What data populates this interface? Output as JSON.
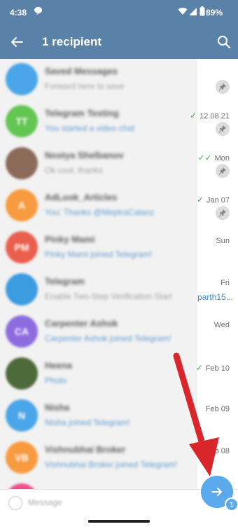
{
  "status_bar": {
    "time": "4:38",
    "battery": "89%"
  },
  "header": {
    "title": "1 recipient"
  },
  "chats": [
    {
      "name": "Saved Messages",
      "preview": "Forward here to save",
      "date": "",
      "ticks": "",
      "pinned": true,
      "avatar_color": "#4aa6e8",
      "avatar_text": "",
      "preview_muted": true
    },
    {
      "name": "Telegram Testing",
      "preview": "You started a video chat",
      "date": "12.08.21",
      "ticks": "✓",
      "pinned": true,
      "avatar_color": "#63c653",
      "avatar_text": "TT",
      "preview_muted": false
    },
    {
      "name": "Nostya Shelbanov",
      "preview": "Ok cool, thanks",
      "date": "Mon",
      "ticks": "✓✓",
      "pinned": true,
      "avatar_color": "#8b6a5a",
      "avatar_text": "",
      "preview_muted": true
    },
    {
      "name": "AdLook_Articles",
      "preview": "You: Thanks @MeptraCalanz",
      "date": "Jan 07",
      "ticks": "✓",
      "pinned": true,
      "avatar_color": "#f89a3f",
      "avatar_text": "A",
      "preview_muted": false
    },
    {
      "name": "Pinky Mami",
      "preview": "Pinky Mami joined Telegram!",
      "date": "Sun",
      "ticks": "",
      "pinned": false,
      "avatar_color": "#e95f4d",
      "avatar_text": "PM",
      "preview_muted": false
    },
    {
      "name": "Telegram",
      "preview": "Enable Two-Step Verification Start",
      "date": "Fri",
      "ticks": "",
      "pinned": false,
      "avatar_color": "#3d9be0",
      "avatar_text": "",
      "preview_muted": true,
      "overflow": "parth15..."
    },
    {
      "name": "Carpenter Ashok",
      "preview": "Carpenter Ashok joined Telegram!",
      "date": "Wed",
      "ticks": "",
      "pinned": false,
      "avatar_color": "#8d6ce0",
      "avatar_text": "CA",
      "preview_muted": false
    },
    {
      "name": "Heena",
      "preview": "Photo",
      "date": "Feb 10",
      "ticks": "✓",
      "pinned": false,
      "avatar_color": "#4d6a3a",
      "avatar_text": "",
      "preview_muted": false
    },
    {
      "name": "Nisha",
      "preview": "Nisha joined Telegram!",
      "date": "Feb 09",
      "ticks": "",
      "pinned": false,
      "avatar_color": "#4aa6e8",
      "avatar_text": "N",
      "preview_muted": false
    },
    {
      "name": "Vishnubhai Broker",
      "preview": "Vishnubhai Broker joined Telegram!",
      "date": "Feb 08",
      "ticks": "",
      "pinned": false,
      "avatar_color": "#f89a3f",
      "avatar_text": "VB",
      "preview_muted": false
    },
    {
      "name": "",
      "preview": "",
      "date": "",
      "ticks": "",
      "pinned": false,
      "avatar_color": "#f24f8a",
      "avatar_text": "",
      "preview_muted": false
    }
  ],
  "input": {
    "placeholder": "Message"
  },
  "send": {
    "count": "1"
  },
  "colors": {
    "header": "#5a82a8",
    "accent": "#5aa9ec",
    "annotation_arrow": "#d9262c"
  }
}
